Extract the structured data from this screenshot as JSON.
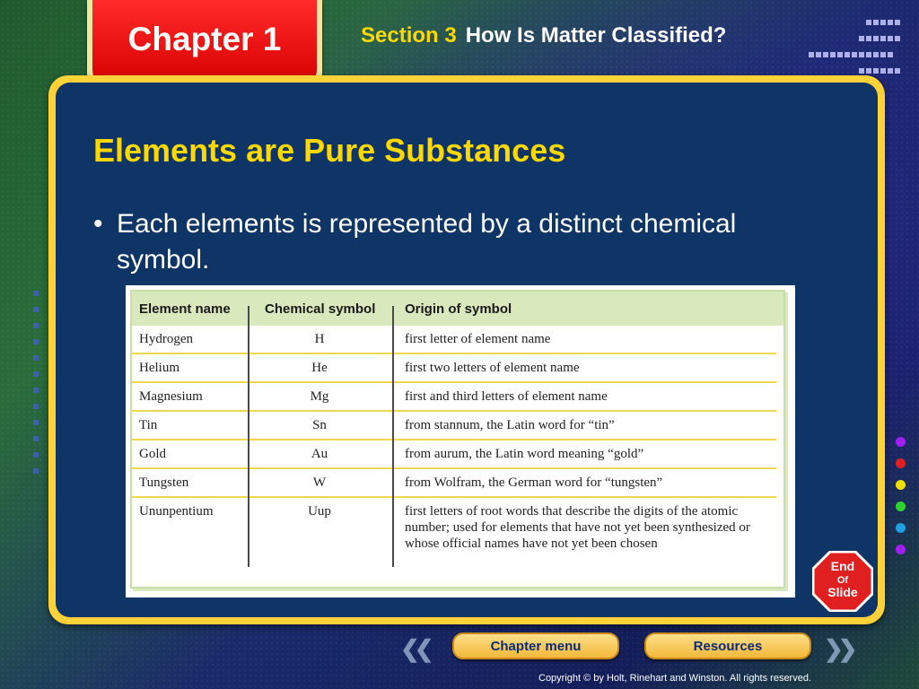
{
  "header": {
    "chapter": "Chapter 1",
    "section_label": "Section 3",
    "section_title": "How Is Matter Classified?"
  },
  "slide": {
    "heading": "Elements are Pure Substances",
    "bullet_mark": "•",
    "bullet": "Each elements is represented by a distinct chemical symbol."
  },
  "table": {
    "columns": [
      "Element name",
      "Chemical symbol",
      "Origin of symbol"
    ],
    "rows": [
      [
        "Hydrogen",
        "H",
        "first letter of element name"
      ],
      [
        "Helium",
        "He",
        "first two letters of element name"
      ],
      [
        "Magnesium",
        "Mg",
        "first and third letters of element name"
      ],
      [
        "Tin",
        "Sn",
        "from stannum, the Latin word for “tin”"
      ],
      [
        "Gold",
        "Au",
        "from aurum, the Latin word meaning “gold”"
      ],
      [
        "Tungsten",
        "W",
        "from Wolfram, the German word for “tungsten”"
      ],
      [
        "Ununpentium",
        "Uup",
        "first letters of root words that describe the digits of the atomic number; used for elements that have not yet been synthesized or whose official names have not yet been chosen"
      ]
    ]
  },
  "nav": {
    "chapter_menu": "Chapter menu",
    "resources": "Resources",
    "end_of_slide": [
      "End",
      "Of",
      "Slide"
    ]
  },
  "footer": {
    "copyright": "Copyright © by Holt, Rinehart and Winston. All rights reserved."
  },
  "colors": {
    "chapter_tab": "#e00000",
    "panel_border": "#ffd23a",
    "panel_fill": "#0f3466",
    "heading": "#ffd800",
    "side_dots": [
      "#a020f0",
      "#e02020",
      "#f0e000",
      "#30d030",
      "#20a0e0",
      "#a020f0"
    ]
  }
}
